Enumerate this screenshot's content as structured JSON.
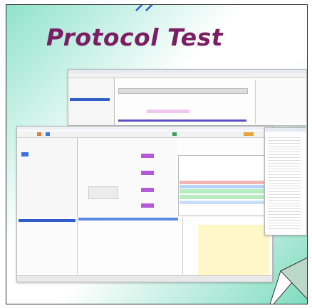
{
  "title": "Protocol Test",
  "colors": {
    "title": "#7b1e63",
    "gradient_light": "#ffffff",
    "gradient_teal": "#8fe3cb",
    "accent_blue": "#2f5ec7",
    "diagram_purple": "#b45ad6"
  },
  "icons": [
    "squiggle-icon",
    "page-fold-icon"
  ]
}
